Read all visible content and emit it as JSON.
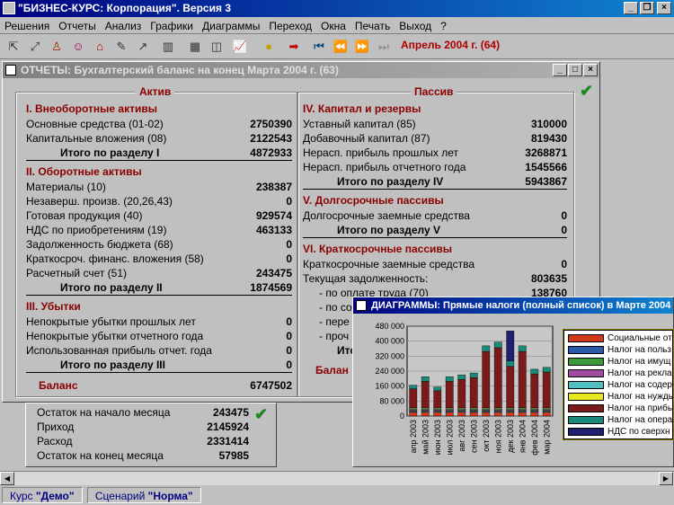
{
  "app": {
    "title": "\"БИЗНЕС-КУРС: Корпорация\". Версия 3",
    "menu": [
      "Решения",
      "Отчеты",
      "Анализ",
      "Графики",
      "Диаграммы",
      "Переход",
      "Окна",
      "Печать",
      "Выход",
      "?"
    ],
    "period": "Апрель 2004 г. (64)"
  },
  "report": {
    "title": "ОТЧЕТЫ: Бухгалтерский баланс на конец  Марта 2004 г. (63)",
    "assets_header": "Актив",
    "liab_header": "Пассив",
    "assets": {
      "s1_title": "I. Внеоборотные активы",
      "s1": [
        [
          "Основные средства (01-02)",
          "2750390"
        ],
        [
          "Капитальные вложения (08)",
          "2122543"
        ]
      ],
      "s1_total": [
        "Итого по разделу I",
        "4872933"
      ],
      "s2_title": "II. Оборотные активы",
      "s2": [
        [
          "Материалы (10)",
          "238387"
        ],
        [
          "Незаверш. произв. (20,26,43)",
          "0"
        ],
        [
          "Готовая продукция (40)",
          "929574"
        ],
        [
          "НДС по приобретениям (19)",
          "463133"
        ],
        [
          "Задолженность бюджета (68)",
          "0"
        ],
        [
          "Краткосроч. финанс. вложения (58)",
          "0"
        ],
        [
          "Расчетный счет (51)",
          "243475"
        ]
      ],
      "s2_total": [
        "Итого по разделу II",
        "1874569"
      ],
      "s3_title": "III. Убытки",
      "s3": [
        [
          "Непокрытые убытки прошлых лет",
          "0"
        ],
        [
          "Непокрытые убытки отчетного года",
          "0"
        ],
        [
          "Использованная прибыль отчет. года",
          "0"
        ]
      ],
      "s3_total": [
        "Итого по разделу III",
        "0"
      ],
      "balance": [
        "Баланс",
        "6747502"
      ]
    },
    "liabilities": {
      "s4_title": "IV. Капитал и резервы",
      "s4": [
        [
          "Уставный капитал (85)",
          "310000"
        ],
        [
          "Добавочный капитал (87)",
          "819430"
        ],
        [
          "Нерасп. прибыль прошлых лет",
          "3268871"
        ],
        [
          "Нерасп. прибыль отчетного года",
          "1545566"
        ]
      ],
      "s4_total": [
        "Итого по разделу IV",
        "5943867"
      ],
      "s5_title": "V. Долгосрочные пассивы",
      "s5": [
        [
          "Долгосрочные заемные средства",
          "0"
        ]
      ],
      "s5_total": [
        "Итого по разделу V",
        "0"
      ],
      "s6_title": "VI. Краткосрочные пассивы",
      "s6": [
        [
          "Краткосрочные заемные средства",
          "0"
        ],
        [
          "Текущая задолженность:",
          "803635"
        ],
        [
          "- по оплате труда (70)",
          "138760"
        ]
      ],
      "s6_partial": [
        "- по со",
        "- пере",
        "- проч",
        "Итог"
      ],
      "balance_partial": "Балан"
    }
  },
  "cash": {
    "rows": [
      [
        "Остаток на начало месяца",
        "243475"
      ],
      [
        "Приход",
        "2145924"
      ],
      [
        "Расход",
        "2331414"
      ],
      [
        "Остаток на конец месяца",
        "57985"
      ]
    ]
  },
  "diagram": {
    "title": "ДИАГРАММЫ: Прямые налоги (полный список) в Марте 2004"
  },
  "chart_data": {
    "type": "bar",
    "stacked": true,
    "categories": [
      "апр 2003",
      "май 2003",
      "июн 2003",
      "июл 2003",
      "авг 2003",
      "сен 2003",
      "окт 2003",
      "ноя 2003",
      "дек 2003",
      "янв 2004",
      "фев 2004",
      "мар 2004"
    ],
    "ylim": [
      0,
      480000
    ],
    "yticks": [
      0,
      80000,
      160000,
      240000,
      320000,
      400000,
      480000
    ],
    "ytick_labels": [
      "0",
      "80 000",
      "160 000",
      "240 000",
      "320 000",
      "400 000",
      "480 000"
    ],
    "series": [
      {
        "name": "Социальные от",
        "color": "#d03a1a",
        "values": [
          20000,
          20000,
          20000,
          20000,
          20000,
          20000,
          20000,
          20000,
          20000,
          20000,
          20000,
          20000
        ]
      },
      {
        "name": "Налог на польз",
        "color": "#2a5aa8",
        "values": [
          5000,
          5000,
          5000,
          5000,
          5000,
          5000,
          5000,
          5000,
          5000,
          5000,
          5000,
          5000
        ]
      },
      {
        "name": "Налог на имущ",
        "color": "#3c9a3c",
        "values": [
          5000,
          5000,
          5000,
          5000,
          5000,
          5000,
          5000,
          5000,
          5000,
          5000,
          5000,
          5000
        ]
      },
      {
        "name": "Налог на рекла",
        "color": "#a04aa0",
        "values": [
          5000,
          5000,
          5000,
          5000,
          5000,
          5000,
          5000,
          5000,
          5000,
          5000,
          5000,
          5000
        ]
      },
      {
        "name": "Налог на содер",
        "color": "#50c0c0",
        "values": [
          5000,
          5000,
          5000,
          5000,
          5000,
          5000,
          5000,
          5000,
          5000,
          5000,
          5000,
          5000
        ]
      },
      {
        "name": "Налог на нужды",
        "color": "#e8e820",
        "values": [
          5000,
          5000,
          5000,
          5000,
          5000,
          5000,
          5000,
          5000,
          5000,
          5000,
          5000,
          5000
        ]
      },
      {
        "name": "Налог на прибы",
        "color": "#7a1a1a",
        "values": [
          100000,
          140000,
          90000,
          140000,
          150000,
          160000,
          300000,
          320000,
          220000,
          300000,
          180000,
          190000
        ]
      },
      {
        "name": "Налог на опера",
        "color": "#1a8a7a",
        "values": [
          20000,
          25000,
          20000,
          25000,
          25000,
          25000,
          30000,
          30000,
          30000,
          30000,
          25000,
          25000
        ]
      },
      {
        "name": "НДС по сверхн",
        "color": "#202070",
        "values": [
          0,
          0,
          0,
          0,
          0,
          0,
          0,
          0,
          160000,
          0,
          0,
          0
        ]
      }
    ]
  },
  "status": {
    "course_label": "Курс",
    "course_value": "\"Демо\"",
    "scenario_label": "Сценарий",
    "scenario_value": "\"Норма\""
  }
}
